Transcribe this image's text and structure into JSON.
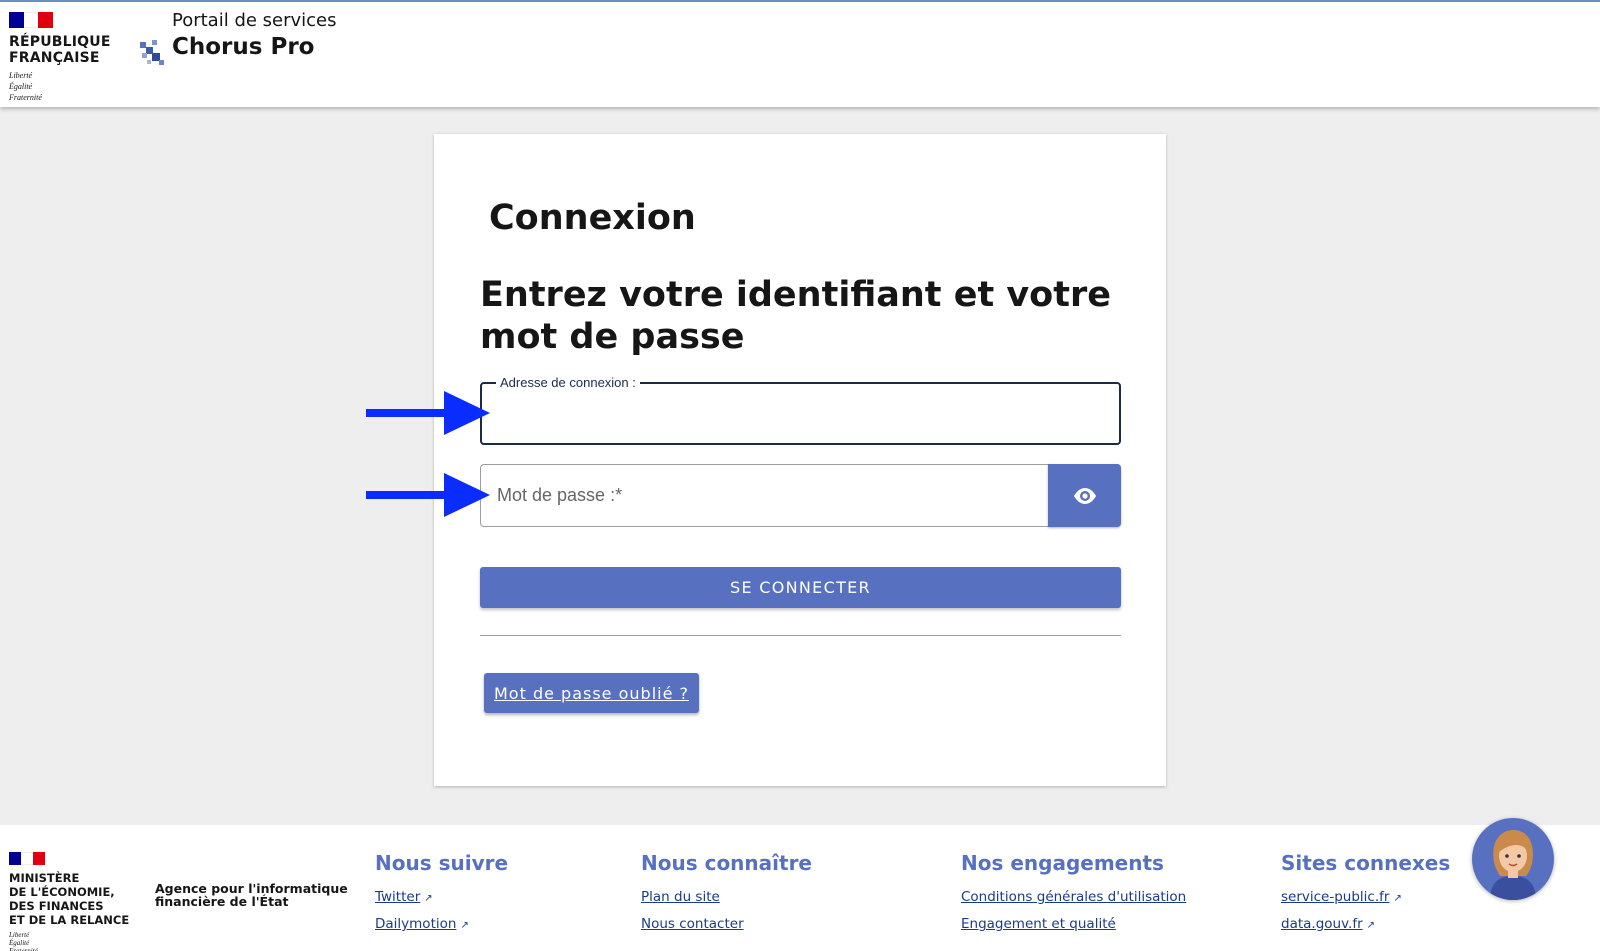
{
  "header": {
    "republique": "RÉPUBLIQUE\nFRANÇAISE",
    "devise": "Liberté\nÉgalité\nFraternité",
    "portal_subtitle": "Portail de services",
    "portal_title": "Chorus Pro"
  },
  "login": {
    "title": "Connexion",
    "instruction": "Entrez votre identifiant et votre mot de passe",
    "login_label": "Adresse de connexion :",
    "login_value": "",
    "password_placeholder": "Mot de passe :*",
    "password_value": "",
    "connect_label": "SE CONNECTER",
    "forgot_label": "Mot de passe oublié ?"
  },
  "footer": {
    "ministere": "MINISTÈRE\nDE L'ÉCONOMIE,\nDES FINANCES\nET DE LA RELANCE",
    "devise": "Liberté\nÉgalité\nFraternité",
    "agency": "Agence pour l'informatique financière de l'État",
    "columns": [
      {
        "title": "Nous suivre",
        "links": [
          "Twitter",
          "Dailymotion"
        ]
      },
      {
        "title": "Nous connaître",
        "links": [
          "Plan du site",
          "Nous contacter"
        ]
      },
      {
        "title": "Nos engagements",
        "links": [
          "Conditions générales d'utilisation",
          "Engagement et qualité"
        ]
      },
      {
        "title": "Sites connexes",
        "links": [
          "service-public.fr",
          "data.gouv.fr"
        ]
      }
    ]
  },
  "colors": {
    "accent": "#5770c0",
    "arrow": "#0a2cff",
    "flag_blue": "#000091",
    "flag_red": "#e1000f"
  },
  "icons": [
    "eye-icon",
    "external-link-icon",
    "chorus-pro-logo",
    "assistant-avatar",
    "arrow-right-icon"
  ]
}
